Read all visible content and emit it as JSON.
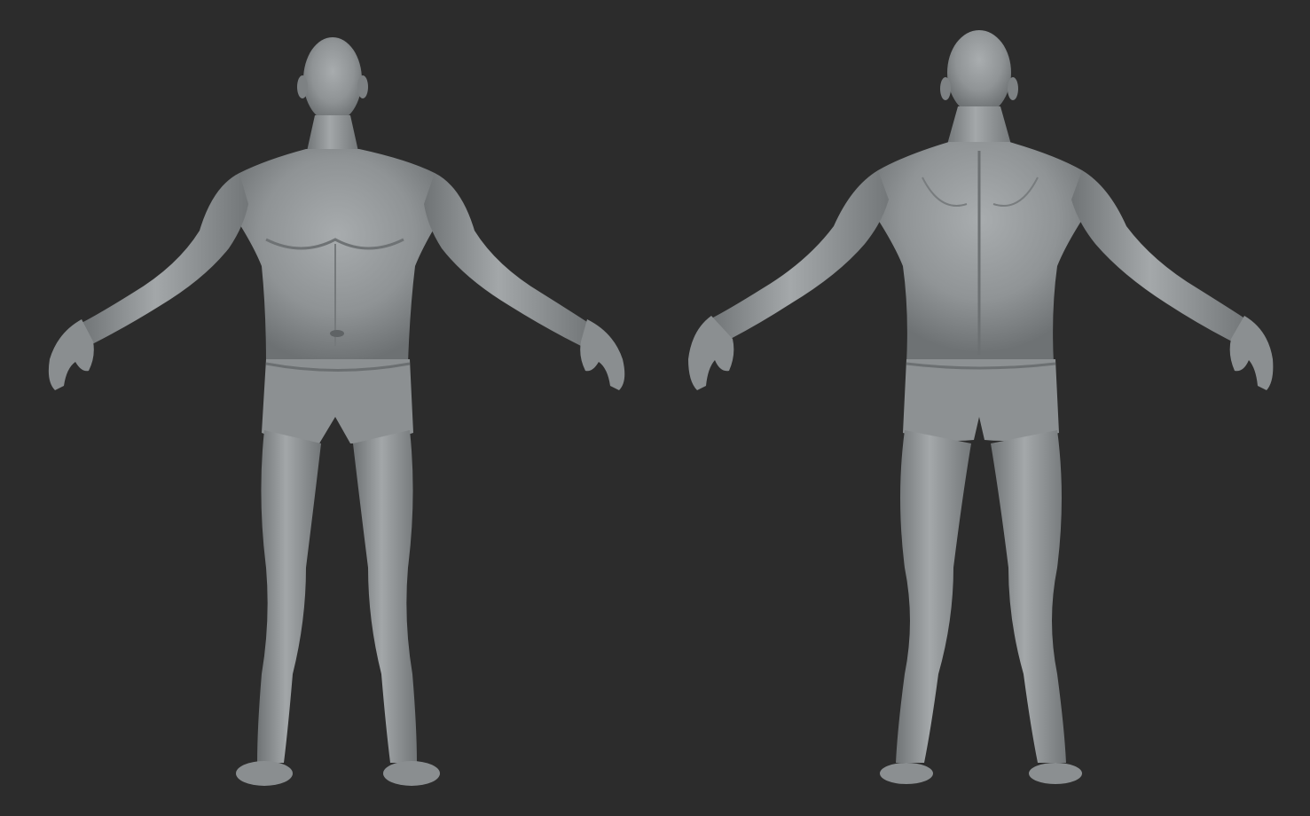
{
  "scene": {
    "background_color": "#2c2c2c",
    "model_color": "#8f9395",
    "views": [
      {
        "view": "front"
      },
      {
        "view": "back"
      }
    ]
  }
}
